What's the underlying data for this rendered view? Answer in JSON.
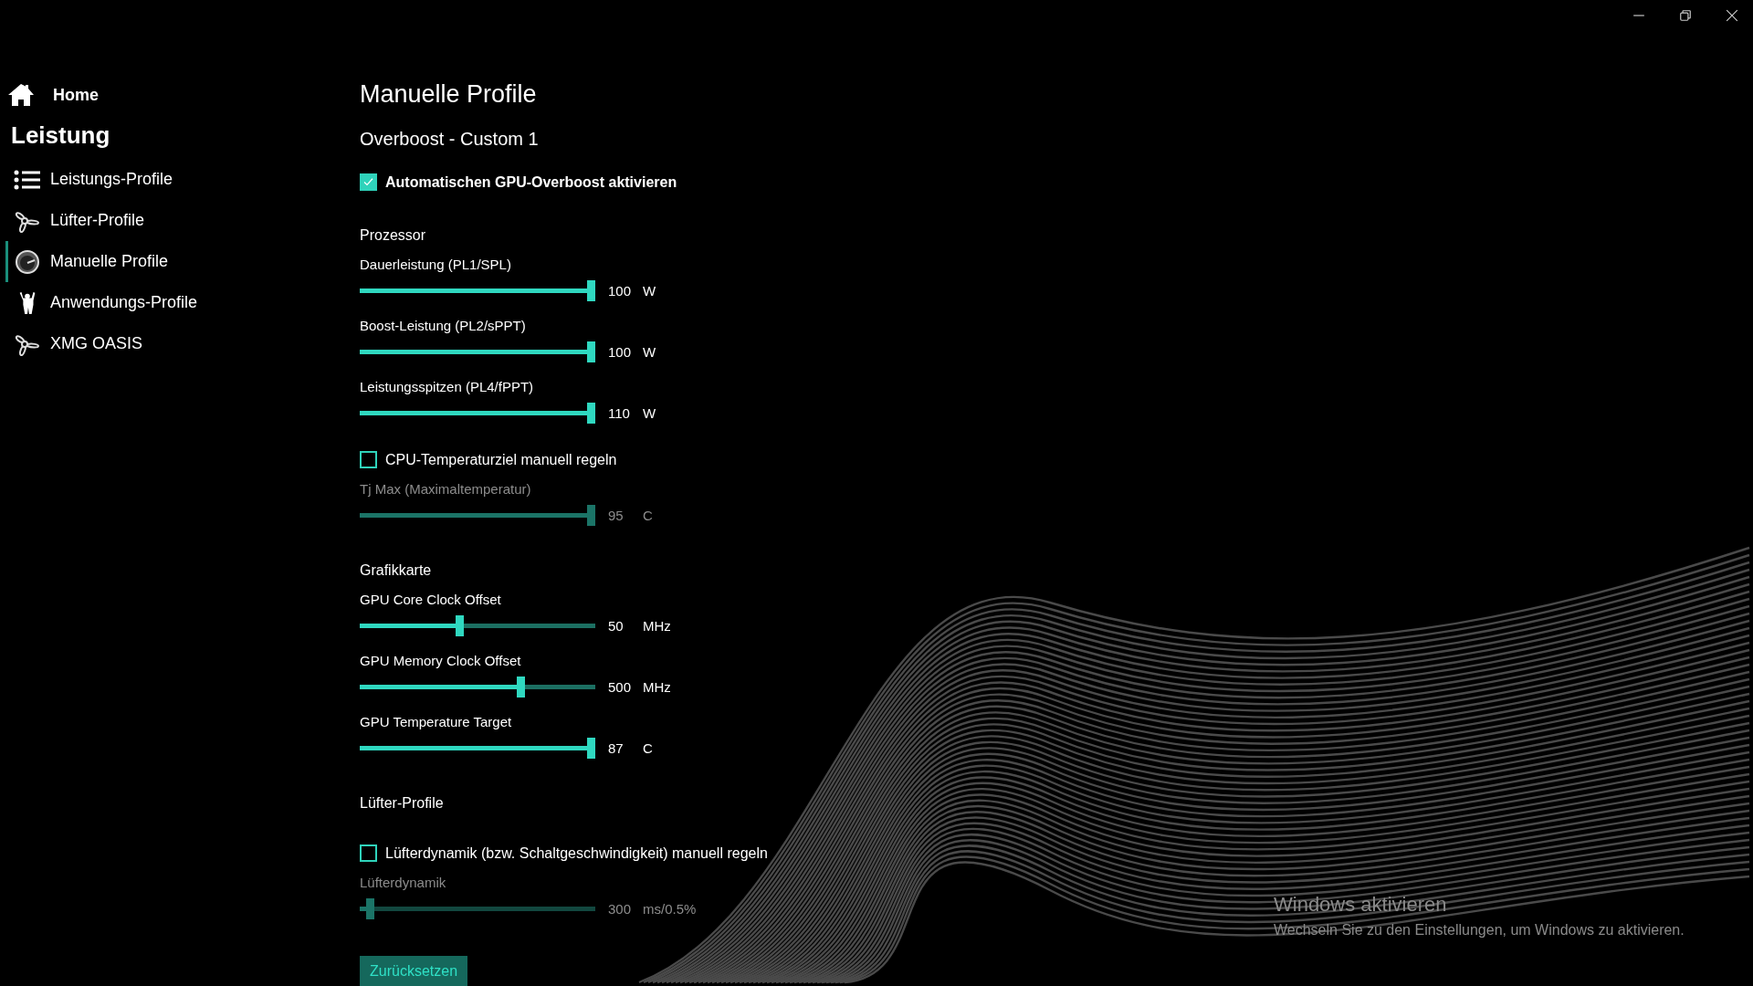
{
  "sidebar": {
    "home": "Home",
    "heading": "Leistung",
    "items": [
      {
        "label": "Leistungs-Profile",
        "selected": false
      },
      {
        "label": "Lüfter-Profile",
        "selected": false
      },
      {
        "label": "Manuelle Profile",
        "selected": true
      },
      {
        "label": "Anwendungs-Profile",
        "selected": false
      },
      {
        "label": "XMG OASIS",
        "selected": false
      }
    ]
  },
  "content": {
    "title": "Manuelle Profile",
    "subtitle": "Overboost - Custom 1",
    "overboost": {
      "label": "Automatischen GPU-Overboost aktivieren",
      "checked": true
    },
    "sections": [
      {
        "heading": "Prozessor",
        "controls": [
          {
            "kind": "slider",
            "label": "Dauerleistung (PL1/SPL)",
            "level": 1,
            "value": "100",
            "unit": "W",
            "disabled": false
          },
          {
            "kind": "slider",
            "label": "Boost-Leistung (PL2/sPPT)",
            "level": 1,
            "value": "100",
            "unit": "W",
            "disabled": false
          },
          {
            "kind": "slider",
            "label": "Leistungsspitzen (PL4/fPPT)",
            "level": 1,
            "value": "110",
            "unit": "W",
            "disabled": false
          },
          {
            "kind": "checkbox",
            "label": "CPU-Temperaturziel manuell regeln",
            "checked": false
          },
          {
            "kind": "slider",
            "label": "Tj Max (Maximaltemperatur)",
            "level": 1,
            "value": "95",
            "unit": "C",
            "disabled": true
          }
        ]
      },
      {
        "heading": "Grafikkarte",
        "controls": [
          {
            "kind": "slider",
            "label": "GPU Core Clock Offset",
            "level": 0.42,
            "value": "50",
            "unit": "MHz",
            "disabled": false
          },
          {
            "kind": "slider",
            "label": "GPU Memory Clock Offset",
            "level": 0.69,
            "value": "500",
            "unit": "MHz",
            "disabled": false
          },
          {
            "kind": "slider",
            "label": "GPU Temperature Target",
            "level": 1,
            "value": "87",
            "unit": "C",
            "disabled": false
          }
        ]
      },
      {
        "heading": "Lüfter-Profile",
        "controls": [
          {
            "kind": "checkbox",
            "label": "Lüfterdynamik (bzw. Schaltgeschwindigkeit) manuell regeln",
            "checked": false
          },
          {
            "kind": "slider",
            "label": "Lüfterdynamik",
            "level": 0.03,
            "value": "300",
            "unit": "ms/0.5%",
            "disabled": true
          }
        ]
      }
    ],
    "reset_button": "Zurücksetzen"
  },
  "activation": {
    "title": "Windows aktivieren",
    "text": "Wechseln Sie zu den Einstellungen, um Windows zu aktivieren."
  }
}
